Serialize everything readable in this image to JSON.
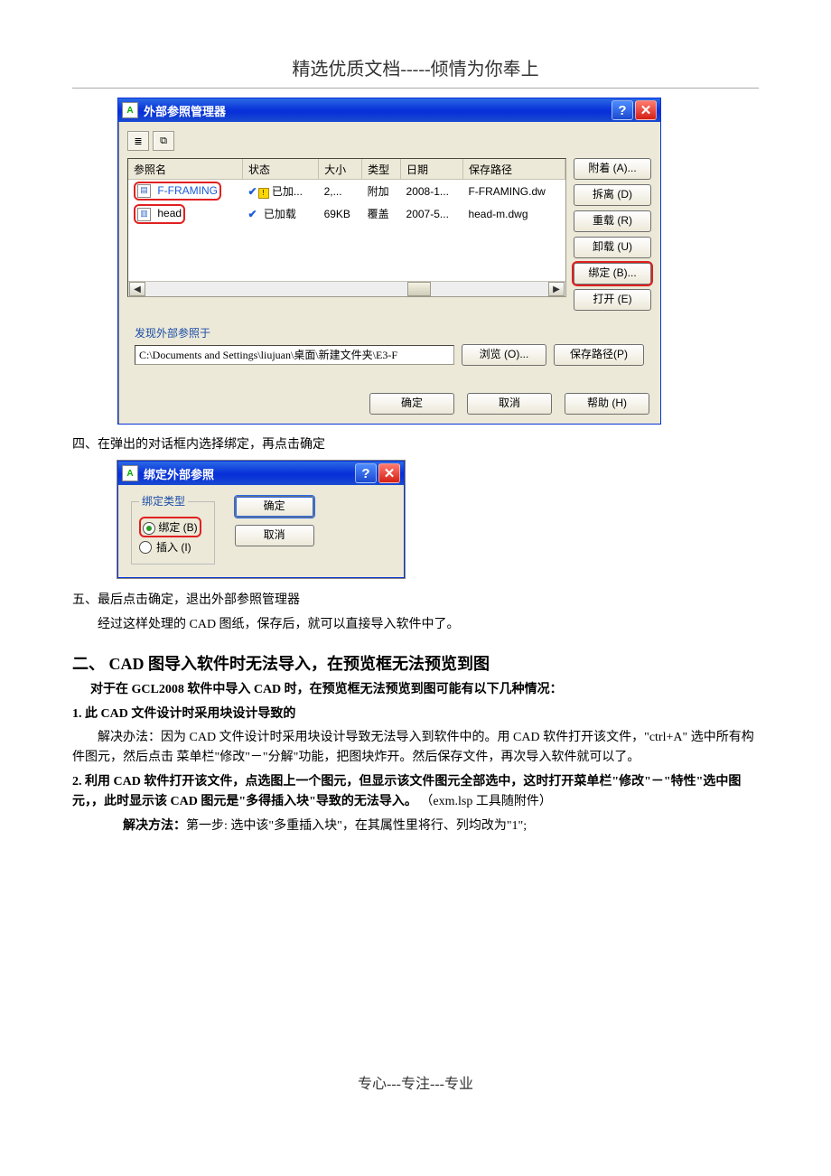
{
  "header": {
    "title": "精选优质文档-----倾情为你奉上"
  },
  "footer": {
    "text": "专心---专注---专业"
  },
  "dialog1": {
    "title": "外部参照管理器",
    "view_icons": [
      "list-view",
      "detail-view"
    ],
    "columns": [
      "参照名",
      "状态",
      "大小",
      "类型",
      "日期",
      "保存路径"
    ],
    "rows": [
      {
        "name": "F-FRAMING",
        "status": "已加...",
        "size": "2,...",
        "type": "附加",
        "date": "2008-1...",
        "path": "F-FRAMING.dw",
        "icon": "xref-attach",
        "warn": true
      },
      {
        "name": "head",
        "status": "已加载",
        "size": "69KB",
        "type": "覆盖",
        "date": "2007-5...",
        "path": "head-m.dwg",
        "icon": "xref-overlay",
        "warn": false
      }
    ],
    "side_buttons": {
      "attach": "附着 (A)...",
      "detach": "拆离 (D)",
      "reload": "重载 (R)",
      "unload": "卸载 (U)",
      "bind": "绑定 (B)...",
      "open": "打开 (E)"
    },
    "find_group": {
      "label": "发现外部参照于",
      "path": "C:\\Documents and Settings\\liujuan\\桌面\\新建文件夹\\E3-F",
      "browse": "浏览 (O)...",
      "savepath": "保存路径(P)"
    },
    "bottom": {
      "ok": "确定",
      "cancel": "取消",
      "help": "帮助 (H)"
    }
  },
  "text_block1": {
    "step4": "四、在弹出的对话框内选择绑定，再点击确定"
  },
  "dialog2": {
    "title": "绑定外部参照",
    "group_label": "绑定类型",
    "radio_bind": "绑定 (B)",
    "radio_insert": "插入 (I)",
    "ok": "确定",
    "cancel": "取消"
  },
  "text_block2": {
    "step5a": "五、最后点击确定，退出外部参照管理器",
    "step5b": "经过这样处理的 CAD 图纸，保存后，就可以直接导入软件中了。"
  },
  "section2": {
    "heading": "二、   CAD 图导入软件时无法导入，在预览框无法预览到图",
    "intro": "对于在 GCL2008 软件中导入 CAD 时，在预览框无法预览到图可能有以下几种情况：",
    "item1_title": "1. 此 CAD 文件设计时采用块设计导致的",
    "item1_body": "解决办法：因为 CAD 文件设计时采用块设计导致无法导入到软件中的。用 CAD 软件打开该文件，\"ctrl+A\" 选中所有构件图元，然后点击 菜单栏\"修改\"－\"分解\"功能，把图块炸开。然后保存文件，再次导入软件就可以了。",
    "item2_title": "2. 利用 CAD 软件打开该文件，点选图上一个图元，但显示该文件图元全部选中，这时打开菜单栏\"修改\"－\"特性\"选中图元，，此时显示该 CAD 图元是\"多得插入块\"导致的无法导入。",
    "item2_note": "（exm.lsp 工具随附件）",
    "item2_body": "解决方法：第一步: 选中该\"多重插入块\"，在其属性里将行、列均改为\"1\";"
  }
}
